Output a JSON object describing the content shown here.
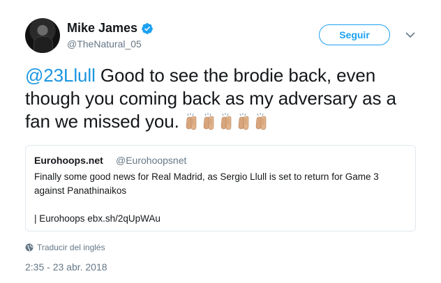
{
  "author": {
    "name": "Mike James",
    "handle": "@TheNatural_05",
    "verified": true
  },
  "follow_button": {
    "label": "Seguir"
  },
  "tweet": {
    "mention": "@23Llull",
    "text": " Good to see the brodie back, even though you coming back as my adversary as a fan we missed you. ",
    "emoji": "clapping-hands-medium-light-skin-tone",
    "emoji_count": 5
  },
  "quoted": {
    "name": "Eurohoops.net",
    "handle": "@Eurohoopsnet",
    "text": "Finally some good news for Real Madrid, as Sergio Llull is set to return for Game 3 against Panathinaikos",
    "source": "| Eurohoops ebx.sh/2qUpWAu"
  },
  "translate_label": "Traducir del inglés",
  "timestamp": "2:35 - 23 abr. 2018",
  "colors": {
    "accent": "#1da1f2",
    "link": "#1b95e0",
    "muted": "#657786",
    "border": "#e1e8ed"
  }
}
